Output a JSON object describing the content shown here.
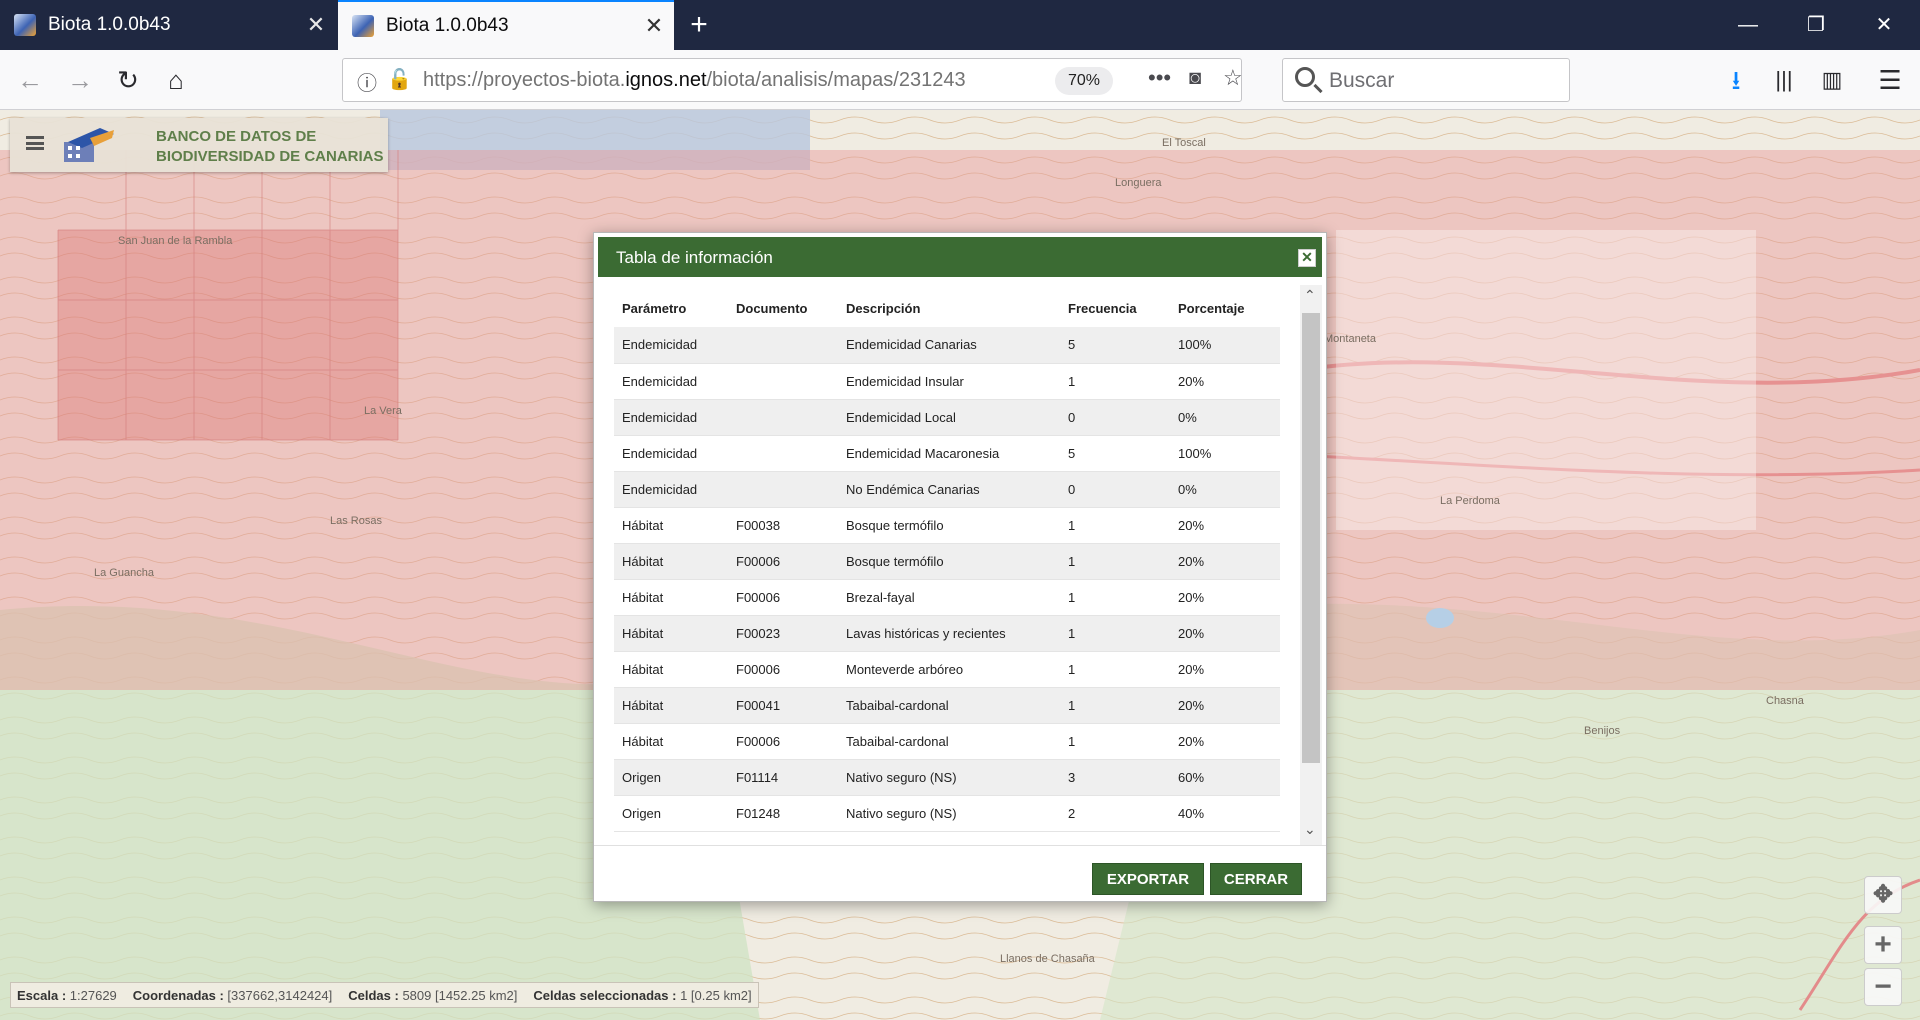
{
  "browser": {
    "tabs": [
      {
        "title": "Biota 1.0.0b43",
        "active": false
      },
      {
        "title": "Biota 1.0.0b43",
        "active": true
      }
    ],
    "new_tab": "+",
    "url_prefix": "https://proyectos-biota.",
    "url_domain": "ignos.net",
    "url_path": "/biota/analisis/mapas/231243",
    "zoom": "70%",
    "search_placeholder": "Buscar",
    "accent_color": "#0a84ff"
  },
  "app": {
    "brand_line1": "BANCO DE DATOS DE",
    "brand_line2": "BIODIVERSIDAD DE CANARIAS",
    "brand_color": "#5f7f4a"
  },
  "map": {
    "place_labels": [
      "El Toscal",
      "Longuera",
      "San Juan de la Rambla",
      "La Vera",
      "Las Rosas",
      "La Guancha",
      "Montaneta",
      "La Perdoma",
      "Chasna",
      "Benijos",
      "Llanos de Chasaña"
    ]
  },
  "dialog": {
    "title": "Tabla de información",
    "header_color": "#3b6b33",
    "columns": [
      "Parámetro",
      "Documento",
      "Descripción",
      "Frecuencia",
      "Porcentaje"
    ],
    "rows": [
      [
        "Endemicidad",
        "",
        "Endemicidad Canarias",
        "5",
        "100%"
      ],
      [
        "Endemicidad",
        "",
        "Endemicidad Insular",
        "1",
        "20%"
      ],
      [
        "Endemicidad",
        "",
        "Endemicidad Local",
        "0",
        "0%"
      ],
      [
        "Endemicidad",
        "",
        "Endemicidad Macaronesia",
        "5",
        "100%"
      ],
      [
        "Endemicidad",
        "",
        "No Endémica Canarias",
        "0",
        "0%"
      ],
      [
        "Hábitat",
        "F00038",
        "Bosque termófilo",
        "1",
        "20%"
      ],
      [
        "Hábitat",
        "F00006",
        "Bosque termófilo",
        "1",
        "20%"
      ],
      [
        "Hábitat",
        "F00006",
        "Brezal-fayal",
        "1",
        "20%"
      ],
      [
        "Hábitat",
        "F00023",
        "Lavas históricas y recientes",
        "1",
        "20%"
      ],
      [
        "Hábitat",
        "F00006",
        "Monteverde arbóreo",
        "1",
        "20%"
      ],
      [
        "Hábitat",
        "F00041",
        "Tabaibal-cardonal",
        "1",
        "20%"
      ],
      [
        "Hábitat",
        "F00006",
        "Tabaibal-cardonal",
        "1",
        "20%"
      ],
      [
        "Origen",
        "F01114",
        "Nativo seguro (NS)",
        "3",
        "60%"
      ],
      [
        "Origen",
        "F01248",
        "Nativo seguro (NS)",
        "2",
        "40%"
      ]
    ],
    "export_label": "EXPORTAR",
    "close_label": "CERRAR"
  },
  "status": {
    "scale_label": "Escala :",
    "scale_value": "1:27629",
    "coords_label": "Coordenadas :",
    "coords_value": "[337662,3142424]",
    "cells_label": "Celdas :",
    "cells_value": "5809 [1452.25 km2]",
    "selected_label": "Celdas seleccionadas :",
    "selected_value": "1 [0.25 km2]"
  }
}
